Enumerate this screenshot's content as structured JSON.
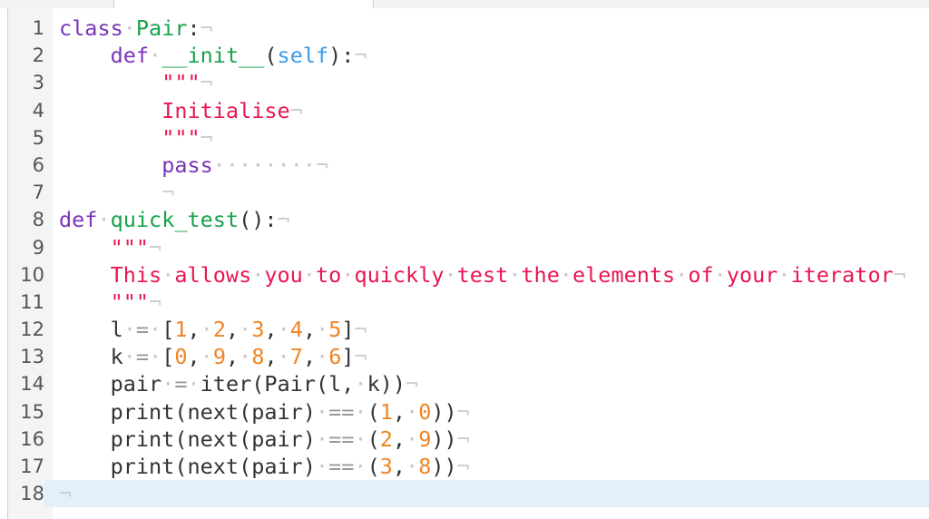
{
  "editor": {
    "current_line": 18,
    "eol_marker": "¬",
    "lines": [
      {
        "n": "1",
        "tokens": [
          [
            "kw",
            "class"
          ],
          [
            "t",
            " "
          ],
          [
            "fn",
            "Pair"
          ],
          [
            "t",
            ":"
          ]
        ]
      },
      {
        "n": "2",
        "tokens": [
          [
            "t",
            "    "
          ],
          [
            "kw",
            "def"
          ],
          [
            "t",
            " "
          ],
          [
            "fn",
            "__init__"
          ],
          [
            "t",
            "("
          ],
          [
            "self",
            "self"
          ],
          [
            "t",
            "):"
          ]
        ]
      },
      {
        "n": "3",
        "tokens": [
          [
            "t",
            "        "
          ],
          [
            "str",
            "\"\"\""
          ]
        ]
      },
      {
        "n": "4",
        "tokens": [
          [
            "t",
            "        "
          ],
          [
            "str",
            "Initialise"
          ]
        ]
      },
      {
        "n": "5",
        "tokens": [
          [
            "t",
            "        "
          ],
          [
            "str",
            "\"\"\""
          ]
        ]
      },
      {
        "n": "6",
        "tokens": [
          [
            "t",
            "        "
          ],
          [
            "kw",
            "pass"
          ],
          [
            "t",
            "        "
          ]
        ]
      },
      {
        "n": "7",
        "tokens": [
          [
            "t",
            "        "
          ]
        ]
      },
      {
        "n": "8",
        "tokens": [
          [
            "kw",
            "def"
          ],
          [
            "t",
            " "
          ],
          [
            "fn",
            "quick_test"
          ],
          [
            "t",
            "():"
          ]
        ]
      },
      {
        "n": "9",
        "tokens": [
          [
            "t",
            "    "
          ],
          [
            "str",
            "\"\"\""
          ]
        ]
      },
      {
        "n": "10",
        "tokens": [
          [
            "t",
            "    "
          ],
          [
            "str",
            "This allows you to quickly test the elements of your iterator"
          ]
        ]
      },
      {
        "n": "11",
        "tokens": [
          [
            "t",
            "    "
          ],
          [
            "str",
            "\"\"\""
          ]
        ]
      },
      {
        "n": "12",
        "tokens": [
          [
            "t",
            "    l "
          ],
          [
            "op",
            "="
          ],
          [
            "t",
            " ["
          ],
          [
            "num",
            "1"
          ],
          [
            "t",
            ", "
          ],
          [
            "num",
            "2"
          ],
          [
            "t",
            ", "
          ],
          [
            "num",
            "3"
          ],
          [
            "t",
            ", "
          ],
          [
            "num",
            "4"
          ],
          [
            "t",
            ", "
          ],
          [
            "num",
            "5"
          ],
          [
            "t",
            "]"
          ]
        ]
      },
      {
        "n": "13",
        "tokens": [
          [
            "t",
            "    k "
          ],
          [
            "op",
            "="
          ],
          [
            "t",
            " ["
          ],
          [
            "num",
            "0"
          ],
          [
            "t",
            ", "
          ],
          [
            "num",
            "9"
          ],
          [
            "t",
            ", "
          ],
          [
            "num",
            "8"
          ],
          [
            "t",
            ", "
          ],
          [
            "num",
            "7"
          ],
          [
            "t",
            ", "
          ],
          [
            "num",
            "6"
          ],
          [
            "t",
            "]"
          ]
        ]
      },
      {
        "n": "14",
        "tokens": [
          [
            "t",
            "    pair "
          ],
          [
            "op",
            "="
          ],
          [
            "t",
            " iter(Pair(l, k))"
          ]
        ]
      },
      {
        "n": "15",
        "tokens": [
          [
            "t",
            "    print(next(pair) "
          ],
          [
            "op",
            "=="
          ],
          [
            "t",
            " ("
          ],
          [
            "num",
            "1"
          ],
          [
            "t",
            ", "
          ],
          [
            "num",
            "0"
          ],
          [
            "t",
            "))"
          ]
        ]
      },
      {
        "n": "16",
        "tokens": [
          [
            "t",
            "    print(next(pair) "
          ],
          [
            "op",
            "=="
          ],
          [
            "t",
            " ("
          ],
          [
            "num",
            "2"
          ],
          [
            "t",
            ", "
          ],
          [
            "num",
            "9"
          ],
          [
            "t",
            "))"
          ]
        ]
      },
      {
        "n": "17",
        "tokens": [
          [
            "t",
            "    print(next(pair) "
          ],
          [
            "op",
            "=="
          ],
          [
            "t",
            " ("
          ],
          [
            "num",
            "3"
          ],
          [
            "t",
            ", "
          ],
          [
            "num",
            "8"
          ],
          [
            "t",
            "))"
          ]
        ]
      },
      {
        "n": "18",
        "tokens": []
      }
    ]
  }
}
